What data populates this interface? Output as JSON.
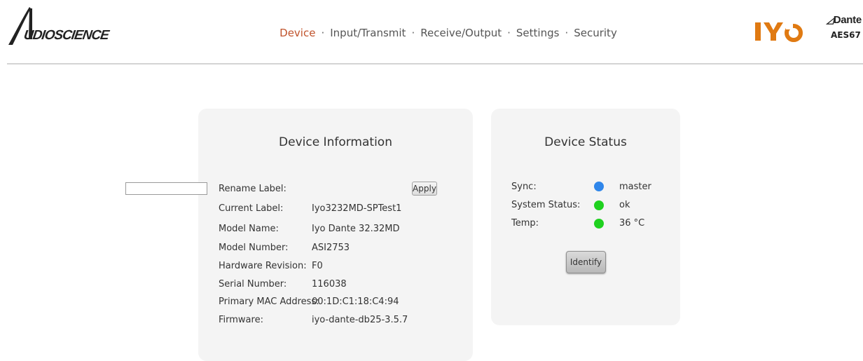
{
  "brand": {
    "logo_text": "AUDIOSCIENCE",
    "product_logo": "IYO",
    "dante_logo": "Dante",
    "aes_label": "AES67"
  },
  "nav": {
    "items": [
      "Device",
      "Input/Transmit",
      "Receive/Output",
      "Settings",
      "Security"
    ],
    "separator": "·",
    "active": "Device"
  },
  "device_info": {
    "title": "Device Information",
    "rename_label": "Rename Label:",
    "rename_value": "",
    "apply_label": "Apply",
    "rows": [
      {
        "label": "Current Label:",
        "value": "Iyo3232MD-SPTest1"
      },
      {
        "label": "Model Name:",
        "value": "Iyo Dante 32.32MD"
      },
      {
        "label": "Model Number:",
        "value": "ASI2753"
      },
      {
        "label": "Hardware Revision:",
        "value": "F0"
      },
      {
        "label": "Serial Number:",
        "value": "116038"
      },
      {
        "label": "Primary MAC Address:",
        "value": "00:1D:C1:18:C4:94"
      },
      {
        "label": "Firmware:",
        "value": "iyo-dante-db25-3.5.7"
      }
    ]
  },
  "device_status": {
    "title": "Device Status",
    "items": [
      {
        "label": "Sync:",
        "value": "master",
        "indicator": "#2f86ea"
      },
      {
        "label": "System Status:",
        "value": "ok",
        "indicator": "#1fd11f"
      },
      {
        "label": "Temp:",
        "value": "36 °C",
        "indicator": "#1fd11f"
      }
    ],
    "identify_label": "Identify"
  },
  "colors": {
    "accent": "#c0532c",
    "panel_bg": "#f4f4f4",
    "brand_orange": "#e07a12"
  }
}
